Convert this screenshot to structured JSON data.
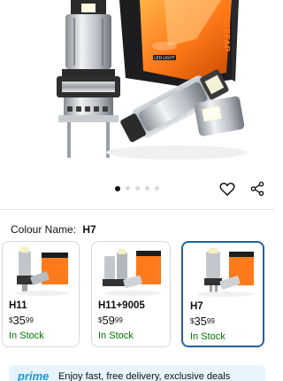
{
  "product": {
    "box_brand": "FREEFAP",
    "box_badge": "LED LIGHT",
    "carousel": {
      "total": 5,
      "active": 0
    }
  },
  "actions": {
    "wishlist_icon": "heart-icon",
    "share_icon": "share-icon"
  },
  "colour": {
    "label": "Colour Name:",
    "selected": "H7"
  },
  "variants": [
    {
      "name": "H11",
      "currency": "$",
      "whole": "35",
      "fraction": "99",
      "stock": "In Stock",
      "selected": false
    },
    {
      "name": "H11+9005",
      "currency": "$",
      "whole": "59",
      "fraction": "99",
      "stock": "In Stock",
      "selected": false
    },
    {
      "name": "H7",
      "currency": "$",
      "whole": "35",
      "fraction": "99",
      "stock": "In Stock",
      "selected": true
    }
  ],
  "prime": {
    "logo": "prime",
    "text": "Enjoy fast, free delivery, exclusive deals"
  },
  "colors": {
    "in_stock": "#007600",
    "selected_border": "#2162a1",
    "prime_blue": "#1399d6"
  }
}
